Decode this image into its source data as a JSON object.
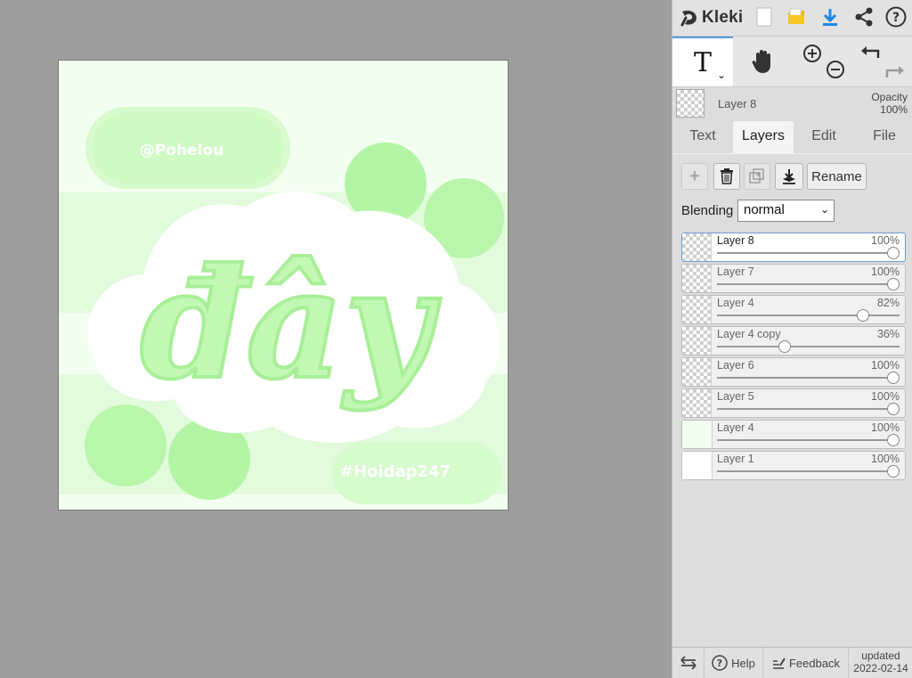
{
  "app": {
    "name": "Kleki",
    "accent_color": "#1e88e5"
  },
  "canvas": {
    "watermark_top": "@Pohelou",
    "watermark_bottom": "#Hoidap247",
    "main_text": "đây",
    "colors": {
      "light": "#e9fde4",
      "mid": "#c9f8bd",
      "strong": "#a9f39a",
      "bg": "#f3fff0"
    }
  },
  "toolbar": {
    "icons": [
      "new-image-icon",
      "open-folder-icon",
      "download-icon",
      "share-icon",
      "help-icon"
    ],
    "tools": [
      "text-tool-icon",
      "hand-tool-icon",
      "zoom-in-icon",
      "zoom-out-icon",
      "undo-icon",
      "redo-icon"
    ]
  },
  "current_layer": {
    "name": "Layer 8",
    "opacity_label": "Opacity",
    "opacity_value": "100%"
  },
  "tabs": [
    {
      "label": "Text",
      "active": false
    },
    {
      "label": "Layers",
      "active": true
    },
    {
      "label": "Edit",
      "active": false
    },
    {
      "label": "File",
      "active": false
    }
  ],
  "layers_panel": {
    "rename_label": "Rename",
    "blending_label": "Blending",
    "blending_value": "normal",
    "layers": [
      {
        "name": "Layer 8",
        "opacity": "100%",
        "value": 1.0,
        "active": true
      },
      {
        "name": "Layer 7",
        "opacity": "100%",
        "value": 1.0,
        "active": false
      },
      {
        "name": "Layer 4",
        "opacity": "82%",
        "value": 0.82,
        "active": false
      },
      {
        "name": "Layer 4 copy",
        "opacity": "36%",
        "value": 0.36,
        "active": false
      },
      {
        "name": "Layer 6",
        "opacity": "100%",
        "value": 1.0,
        "active": false
      },
      {
        "name": "Layer 5",
        "opacity": "100%",
        "value": 1.0,
        "active": false
      },
      {
        "name": "Layer 4",
        "opacity": "100%",
        "value": 1.0,
        "active": false
      },
      {
        "name": "Layer 1",
        "opacity": "100%",
        "value": 1.0,
        "active": false
      }
    ]
  },
  "footer": {
    "help_label": "Help",
    "feedback_label": "Feedback",
    "updated_label": "updated",
    "updated_date": "2022-02-14"
  }
}
